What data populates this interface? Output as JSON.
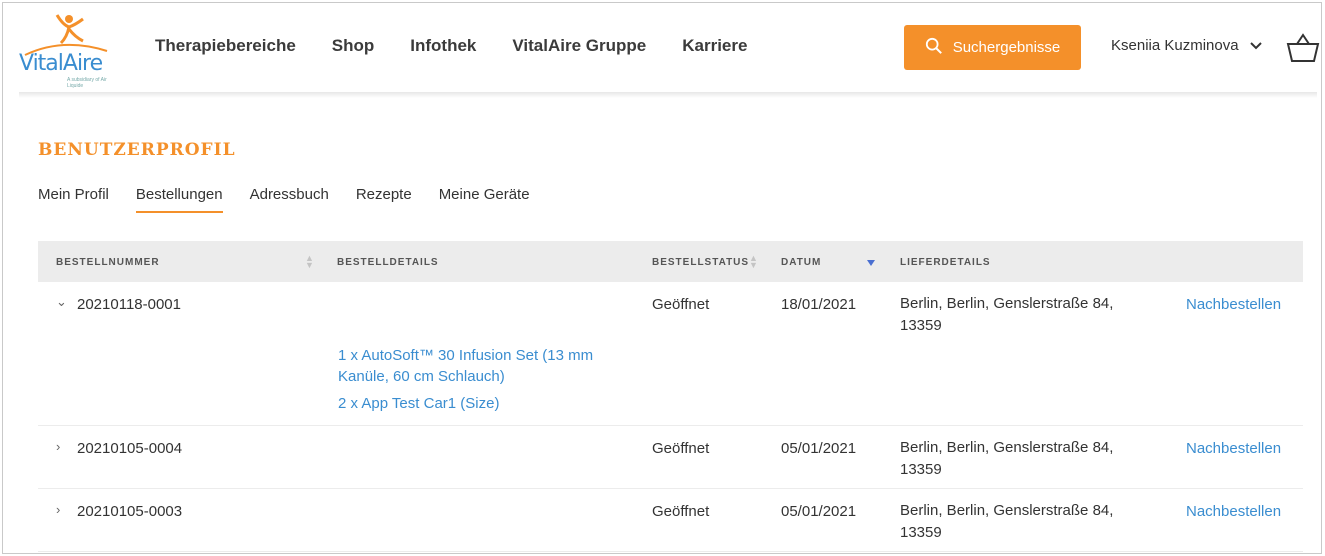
{
  "header": {
    "logo_text": "VitalAire",
    "logo_subtext": "A subsidiary of Air Liquide",
    "nav": [
      "Therapiebereiche",
      "Shop",
      "Infothek",
      "VitalAire Gruppe",
      "Karriere"
    ],
    "search_button": "Suchergebnisse",
    "user_name": "Kseniia Kuzminova",
    "brand_color": "#f4902a",
    "link_color": "#3a8dd0"
  },
  "profile": {
    "title": "BENUTZERPROFIL",
    "tabs": [
      "Mein Profil",
      "Bestellungen",
      "Adressbuch",
      "Rezepte",
      "Meine Geräte"
    ],
    "active_tab": "Bestellungen"
  },
  "table": {
    "headers": {
      "order_number": "BESTELLNUMMER",
      "details": "BESTELLDETAILS",
      "status": "BESTELLSTATUS",
      "date": "DATUM",
      "delivery": "LIEFERDETAILS"
    },
    "sorted_by": "DATUM",
    "rows": [
      {
        "expanded": true,
        "order_number": "20210118-0001",
        "items": [
          "1 x AutoSoft™ 30 Infusion Set (13 mm",
          "Kanüle, 60 cm Schlauch)",
          "2 x App Test Car1 (Size)"
        ],
        "status": "Geöffnet",
        "date": "18/01/2021",
        "delivery_line1": "Berlin, Berlin, Genslerstraße 84,",
        "delivery_line2": "13359",
        "action": "Nachbestellen"
      },
      {
        "expanded": false,
        "order_number": "20210105-0004",
        "status": "Geöffnet",
        "date": "05/01/2021",
        "delivery_line1": "Berlin, Berlin, Genslerstraße 84,",
        "delivery_line2": "13359",
        "action": "Nachbestellen"
      },
      {
        "expanded": false,
        "order_number": "20210105-0003",
        "status": "Geöffnet",
        "date": "05/01/2021",
        "delivery_line1": "Berlin, Berlin, Genslerstraße 84,",
        "delivery_line2": "13359",
        "action": "Nachbestellen"
      }
    ]
  }
}
